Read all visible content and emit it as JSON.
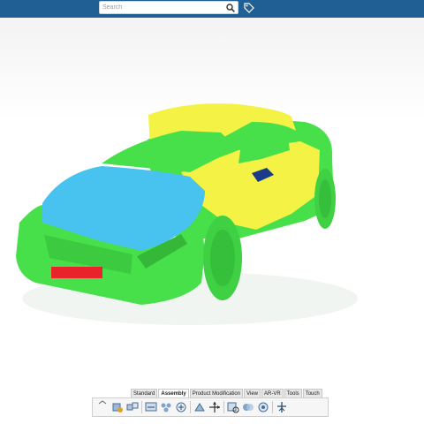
{
  "search": {
    "placeholder": "Search"
  },
  "tabs": [
    {
      "label": "Standard"
    },
    {
      "label": "Assembly"
    },
    {
      "label": "Product Modification"
    },
    {
      "label": "View"
    },
    {
      "label": "AR-VR"
    },
    {
      "label": "Tools"
    },
    {
      "label": "Touch"
    }
  ],
  "active_tab": "Assembly",
  "colors": {
    "topbar": "#1f5f93",
    "car_green": "#47e04a",
    "car_yellow": "#f4f245",
    "car_blue": "#48c2ef",
    "plate_red": "#e8232b"
  },
  "icons": [
    "collapse-toolbar-icon",
    "insert-product-icon",
    "replace-component-icon",
    "rename-icon",
    "pattern-icon",
    "constraints-icon",
    "snap-icon",
    "move-compass-icon",
    "analyze-icon",
    "clash-icon",
    "generate-numbering-icon",
    "publication-icon"
  ]
}
